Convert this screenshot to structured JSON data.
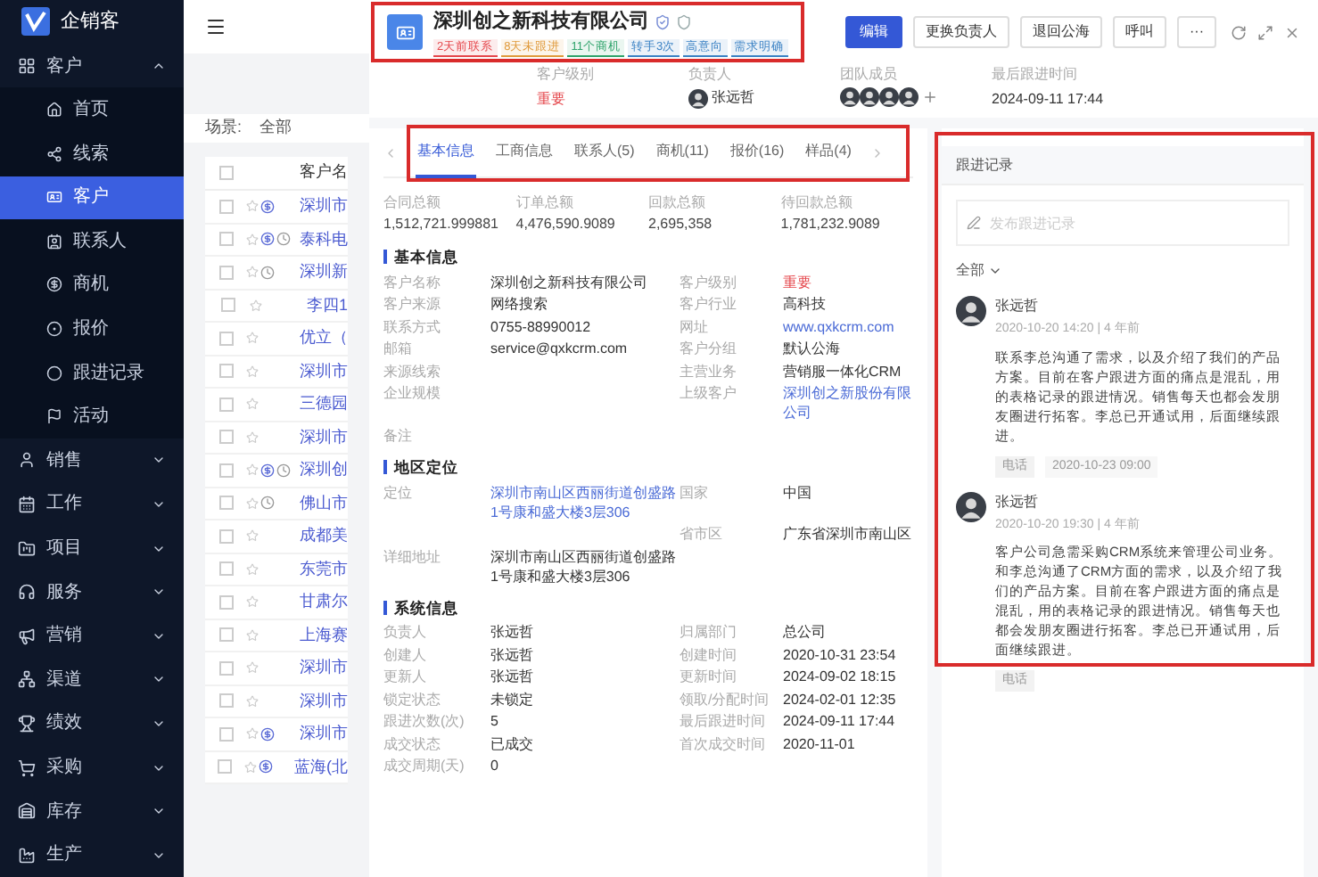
{
  "sidebar": {
    "logo": "企销客",
    "groups": [
      {
        "label": "客户",
        "expanded": true,
        "children": [
          {
            "label": "首页",
            "selected": false
          },
          {
            "label": "线索",
            "selected": false
          },
          {
            "label": "客户",
            "selected": true
          },
          {
            "label": "联系人",
            "selected": false
          },
          {
            "label": "商机",
            "selected": false
          },
          {
            "label": "报价",
            "selected": false
          },
          {
            "label": "跟进记录",
            "selected": false
          },
          {
            "label": "活动",
            "selected": false
          }
        ]
      },
      {
        "label": "销售",
        "expanded": false
      },
      {
        "label": "工作",
        "expanded": false
      },
      {
        "label": "项目",
        "expanded": false
      },
      {
        "label": "服务",
        "expanded": false
      },
      {
        "label": "营销",
        "expanded": false
      },
      {
        "label": "渠道",
        "expanded": false
      },
      {
        "label": "绩效",
        "expanded": false
      },
      {
        "label": "采购",
        "expanded": false
      },
      {
        "label": "库存",
        "expanded": false
      },
      {
        "label": "生产",
        "expanded": false
      }
    ]
  },
  "list": {
    "scene_label": "场景:",
    "scene_value": "全部",
    "column_header": "客户名",
    "all_checked": false,
    "rows": [
      {
        "name": "深圳市",
        "checked": false,
        "marks": [
          {
            "kind": "dollar"
          }
        ]
      },
      {
        "name": "泰科电",
        "checked": false,
        "marks": [
          {
            "kind": "dollar"
          },
          {
            "kind": "clock"
          }
        ]
      },
      {
        "name": "深圳新",
        "checked": false,
        "marks": [
          {
            "kind": "clock"
          }
        ]
      },
      {
        "name": "李四1",
        "checked": false,
        "marks": []
      },
      {
        "name": "优立（",
        "checked": false,
        "marks": []
      },
      {
        "name": "深圳市",
        "checked": false,
        "marks": []
      },
      {
        "name": "三德园",
        "checked": false,
        "marks": []
      },
      {
        "name": "深圳市",
        "checked": false,
        "marks": []
      },
      {
        "name": "深圳创",
        "checked": false,
        "marks": [
          {
            "kind": "dollar"
          },
          {
            "kind": "clock"
          }
        ]
      },
      {
        "name": "佛山市",
        "checked": false,
        "marks": [
          {
            "kind": "clock"
          }
        ]
      },
      {
        "name": "成都美",
        "checked": false,
        "marks": []
      },
      {
        "name": "东莞市",
        "checked": false,
        "marks": []
      },
      {
        "name": "甘肃尔",
        "checked": false,
        "marks": []
      },
      {
        "name": "上海赛",
        "checked": false,
        "marks": []
      },
      {
        "name": "深圳市",
        "checked": false,
        "marks": []
      },
      {
        "name": "深圳市",
        "checked": false,
        "marks": []
      },
      {
        "name": "深圳市",
        "checked": false,
        "marks": [
          {
            "kind": "dollar"
          }
        ]
      },
      {
        "name": "蓝海(北",
        "checked": false,
        "marks": [
          {
            "kind": "dollar"
          }
        ]
      }
    ]
  },
  "detail": {
    "title": "深圳创之新科技有限公司",
    "tags": [
      {
        "label": "2天前联系",
        "color": "#e5484d"
      },
      {
        "label": "8天未跟进",
        "color": "#e09b3d"
      },
      {
        "label": "11个商机",
        "color": "#2fa36b"
      },
      {
        "label": "转手3次",
        "color": "#3b82c4"
      },
      {
        "label": "高意向",
        "color": "#3b82c4"
      },
      {
        "label": "需求明确",
        "color": "#3b82c4"
      }
    ],
    "buttons": [
      {
        "label": "编辑",
        "kind": "primary"
      },
      {
        "label": "更换负责人",
        "kind": "default"
      },
      {
        "label": "退回公海",
        "kind": "default"
      },
      {
        "label": "呼叫",
        "kind": "default"
      },
      {
        "label": "···",
        "kind": "default"
      }
    ],
    "summary": {
      "level_label": "客户级别",
      "level_value": "重要",
      "owner_label": "负责人",
      "owner_name": "张远哲",
      "team_label": "团队成员",
      "last_label": "最后跟进时间",
      "last_value": "2024-09-11 17:44"
    },
    "tabs": [
      {
        "label": "基本信息",
        "selected": true
      },
      {
        "label": "工商信息",
        "selected": false
      },
      {
        "label": "联系人(5)",
        "selected": false
      },
      {
        "label": "商机(11)",
        "selected": false
      },
      {
        "label": "报价(16)",
        "selected": false
      },
      {
        "label": "样品(4)",
        "selected": false
      }
    ],
    "stats": [
      {
        "label": "合同总额",
        "value": "1,512,721.999881"
      },
      {
        "label": "订单总额",
        "value": "4,476,590.9089"
      },
      {
        "label": "回款总额",
        "value": "2,695,358"
      },
      {
        "label": "待回款总额",
        "value": "1,781,232.9089"
      }
    ],
    "sections": [
      {
        "title": "基本信息",
        "rows": [
          {
            "left": {
              "label": "客户名称",
              "value": "深圳创之新科技有限公司",
              "kind": "text"
            },
            "right": {
              "label": "客户级别",
              "value": "重要",
              "kind": "danger"
            }
          },
          {
            "left": {
              "label": "客户来源",
              "value": "网络搜索",
              "kind": "text"
            },
            "right": {
              "label": "客户行业",
              "value": "高科技",
              "kind": "text"
            }
          },
          {
            "left": {
              "label": "联系方式",
              "value": "0755-88990012",
              "kind": "text"
            },
            "right": {
              "label": "网址",
              "value": "www.qxkcrm.com",
              "kind": "link"
            }
          },
          {
            "left": {
              "label": "邮箱",
              "value": "service@qxkcrm.com",
              "kind": "text"
            },
            "right": {
              "label": "客户分组",
              "value": "默认公海",
              "kind": "text"
            }
          },
          {
            "left": {
              "label": "来源线索"
            },
            "right": {
              "label": "主营业务",
              "value": "营销服一体化CRM",
              "kind": "text"
            }
          },
          {
            "left": {
              "label": "企业规模"
            },
            "right": {
              "label": "上级客户",
              "value": "深圳创之新股份有限公司",
              "kind": "link"
            }
          },
          {
            "left": {
              "label": "备注"
            }
          }
        ]
      },
      {
        "title": "地区定位",
        "rows": [
          {
            "left": {
              "label": "定位",
              "value": "深圳市南山区西丽街道创盛路1号康和盛大楼3层306",
              "kind": "link"
            },
            "right": {
              "label": "国家",
              "value": "中国",
              "kind": "text"
            }
          },
          {
            "right": {
              "label": "省市区",
              "value": "广东省深圳市南山区",
              "kind": "text"
            }
          },
          {
            "left": {
              "label": "详细地址",
              "value": "深圳市南山区西丽街道创盛路1号康和盛大楼3层306",
              "kind": "text"
            }
          }
        ]
      },
      {
        "title": "系统信息",
        "rows": [
          {
            "left": {
              "label": "负责人",
              "value": "张远哲",
              "kind": "text"
            },
            "right": {
              "label": "归属部门",
              "value": "总公司",
              "kind": "text"
            }
          },
          {
            "left": {
              "label": "创建人",
              "value": "张远哲",
              "kind": "text"
            },
            "right": {
              "label": "创建时间",
              "value": "2020-10-31 23:54",
              "kind": "text"
            }
          },
          {
            "left": {
              "label": "更新人",
              "value": "张远哲",
              "kind": "text"
            },
            "right": {
              "label": "更新时间",
              "value": "2024-09-02 18:15",
              "kind": "text"
            }
          },
          {
            "left": {
              "label": "锁定状态",
              "value": "未锁定",
              "kind": "text"
            },
            "right": {
              "label": "领取/分配时间",
              "value": "2024-02-01 12:35",
              "kind": "text"
            }
          },
          {
            "left": {
              "label": "跟进次数(次)",
              "value": "5",
              "kind": "text"
            },
            "right": {
              "label": "最后跟进时间",
              "value": "2024-09-11 17:44",
              "kind": "text"
            }
          },
          {
            "left": {
              "label": "成交状态",
              "value": "已成交",
              "kind": "text"
            },
            "right": {
              "label": "首次成交时间",
              "value": "2020-11-01",
              "kind": "text"
            }
          },
          {
            "left": {
              "label": "成交周期(天)",
              "value": "0",
              "kind": "text"
            }
          }
        ]
      }
    ]
  },
  "followups": {
    "title": "跟进记录",
    "input_placeholder": "发布跟进记录",
    "filter": "全部",
    "records": [
      {
        "author": "张远哲",
        "time": "2020-10-20 14:20 | 4 年前",
        "text": "联系李总沟通了需求，以及介绍了我们的产品方案。目前在客户跟进方面的痛点是混乱，用的表格记录的跟进情况。销售每天也都会发朋友圈进行拓客。李总已开通试用，后面继续跟进。",
        "tag": "电话",
        "next": "2020-10-23 09:00"
      },
      {
        "author": "张远哲",
        "time": "2020-10-20 19:30 | 4 年前",
        "text": "客户公司急需采购CRM系统来管理公司业务。和李总沟通了CRM方面的需求，以及介绍了我们的产品方案。目前在客户跟进方面的痛点是混乱，用的表格记录的跟进情况。销售每天也都会发朋友圈进行拓客。李总已开通试用，后面继续跟进。",
        "tag": "电话"
      }
    ]
  }
}
